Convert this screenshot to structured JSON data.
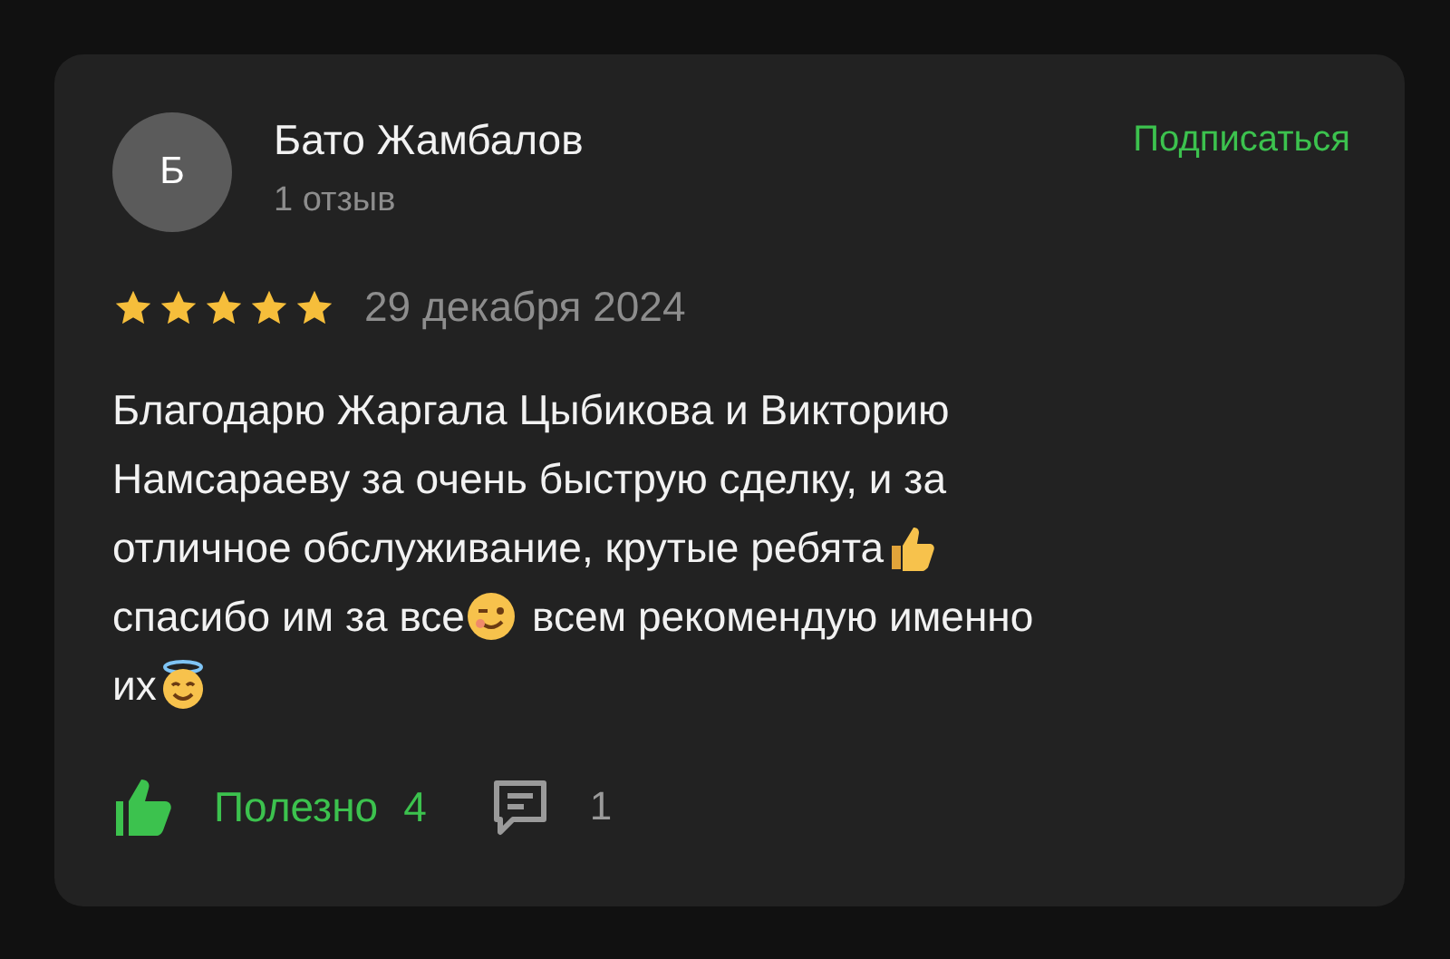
{
  "review": {
    "avatar_letter": "Б",
    "author": "Бато Жамбалов",
    "author_reviews": "1 отзыв",
    "subscribe": "Подписаться",
    "stars": 5,
    "date": "29 декабря 2024",
    "body_lines": [
      [
        {
          "kind": "text",
          "text": "Благодарю Жаргала Цыбикова и Викторию"
        }
      ],
      [
        {
          "kind": "text",
          "text": "Намсараеву за очень быструю сделку, и за"
        }
      ],
      [
        {
          "kind": "text",
          "text": "отличное обслуживание, крутые ребята"
        },
        {
          "kind": "thumbs-up"
        }
      ],
      [
        {
          "kind": "text",
          "text": "спасибо им за все"
        },
        {
          "kind": "wink"
        },
        {
          "kind": "text",
          "text": "всем рекомендую именно"
        }
      ],
      [
        {
          "kind": "text",
          "text": "их"
        },
        {
          "kind": "halo"
        }
      ]
    ],
    "helpful_label": "Полезно",
    "helpful_count": "4",
    "comments_count": "1"
  }
}
